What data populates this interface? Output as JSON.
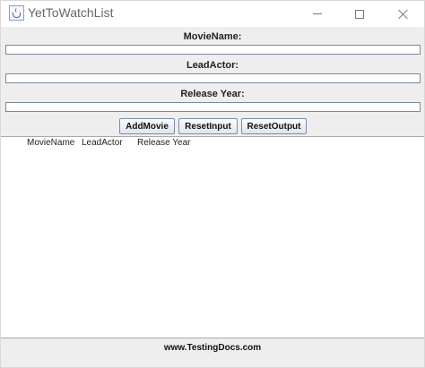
{
  "window": {
    "title": "YetToWatchList",
    "icon": "java-app-icon"
  },
  "form": {
    "movie_name_label": "MovieName:",
    "movie_name_value": "",
    "lead_actor_label": "LeadActor:",
    "lead_actor_value": "",
    "release_year_label": "Release Year:",
    "release_year_value": ""
  },
  "buttons": {
    "add_movie": "AddMovie",
    "reset_input": "ResetInput",
    "reset_output": "ResetOutput"
  },
  "output": {
    "columns": [
      "MovieName",
      "LeadActor",
      "Release Year"
    ]
  },
  "footer": {
    "text": "www.TestingDocs.com"
  }
}
